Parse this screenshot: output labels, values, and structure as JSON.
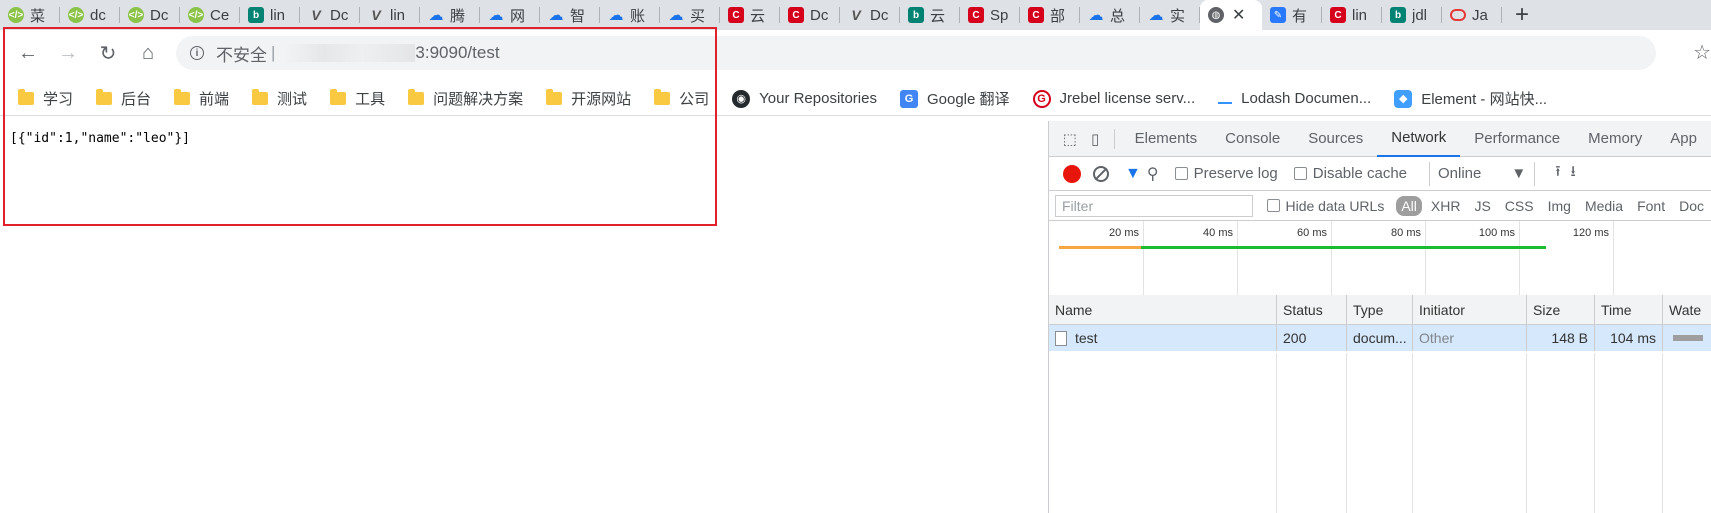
{
  "tabs": [
    {
      "icon": "green-code-icon",
      "title": "菜"
    },
    {
      "icon": "green-code-icon",
      "title": "dc"
    },
    {
      "icon": "green-code-icon",
      "title": "Dc"
    },
    {
      "icon": "green-code-icon",
      "title": "Ce"
    },
    {
      "icon": "bing-icon",
      "title": "lin"
    },
    {
      "icon": "v-icon",
      "title": "Dc"
    },
    {
      "icon": "v-icon",
      "title": "lin"
    },
    {
      "icon": "cloud-icon",
      "title": "腾"
    },
    {
      "icon": "cloud-icon",
      "title": "网"
    },
    {
      "icon": "cloud-icon",
      "title": "智"
    },
    {
      "icon": "cloud-icon",
      "title": "账"
    },
    {
      "icon": "cloud-icon",
      "title": "买"
    },
    {
      "icon": "csdn-icon",
      "title": "云"
    },
    {
      "icon": "csdn-icon",
      "title": "Dc"
    },
    {
      "icon": "v-icon",
      "title": "Dc"
    },
    {
      "icon": "bing-icon",
      "title": "云"
    },
    {
      "icon": "csdn-icon",
      "title": "Sp"
    },
    {
      "icon": "csdn-icon",
      "title": "部"
    },
    {
      "icon": "cloud-icon",
      "title": "总"
    },
    {
      "icon": "cloud-icon",
      "title": "实"
    },
    {
      "icon": "globe-icon",
      "title": "",
      "active": true,
      "close": "✕"
    },
    {
      "icon": "doc-blue-icon",
      "title": "有"
    },
    {
      "icon": "csdn-icon",
      "title": "lin"
    },
    {
      "icon": "bing-icon",
      "title": "jdl"
    },
    {
      "icon": "pill-icon",
      "title": "Ja"
    }
  ],
  "new_tab_label": "+",
  "omnibox": {
    "security_label": "不安全",
    "separator": "|",
    "url_visible": "3:9090/test"
  },
  "bookmarks": [
    {
      "icon": "folder-icon",
      "label": "学习"
    },
    {
      "icon": "folder-icon",
      "label": "后台"
    },
    {
      "icon": "folder-icon",
      "label": "前端"
    },
    {
      "icon": "folder-icon",
      "label": "测试"
    },
    {
      "icon": "folder-icon",
      "label": "工具"
    },
    {
      "icon": "folder-icon",
      "label": "问题解决方案"
    },
    {
      "icon": "folder-icon",
      "label": "开源网站"
    },
    {
      "icon": "folder-icon",
      "label": "公司"
    },
    {
      "icon": "github-icon",
      "label": "Your Repositories"
    },
    {
      "icon": "google-translate-icon",
      "label": "Google 翻译"
    },
    {
      "icon": "jrebel-icon",
      "label": "Jrebel license serv..."
    },
    {
      "icon": "lodash-icon",
      "label": "Lodash Documen..."
    },
    {
      "icon": "element-icon",
      "label": "Element - 网站快..."
    }
  ],
  "page": {
    "body_text": "[{\"id\":1,\"name\":\"leo\"}]"
  },
  "devtools": {
    "tabs": [
      "Elements",
      "Console",
      "Sources",
      "Network",
      "Performance",
      "Memory",
      "App"
    ],
    "active_tab": "Network",
    "preserve_log": "Preserve log",
    "disable_cache": "Disable cache",
    "throttle": "Online",
    "filter_placeholder": "Filter",
    "hide_data_urls": "Hide data URLs",
    "types": [
      "All",
      "XHR",
      "JS",
      "CSS",
      "Img",
      "Media",
      "Font",
      "Doc"
    ],
    "active_type": "All",
    "timeline_ticks": [
      "20 ms",
      "40 ms",
      "60 ms",
      "80 ms",
      "100 ms",
      "120 ms"
    ],
    "columns": [
      "Name",
      "Status",
      "Type",
      "Initiator",
      "Size",
      "Time",
      "Wate"
    ],
    "requests": [
      {
        "name": "test",
        "status": "200",
        "type": "docum...",
        "initiator": "Other",
        "size": "148 B",
        "time": "104 ms"
      }
    ]
  },
  "colors": {
    "highlight_box": "#e0202b",
    "record_button": "#e8150c",
    "selected_row": "#d6e8fb",
    "timeline_orange": "#f7a641",
    "timeline_green": "#1dbb2f"
  }
}
